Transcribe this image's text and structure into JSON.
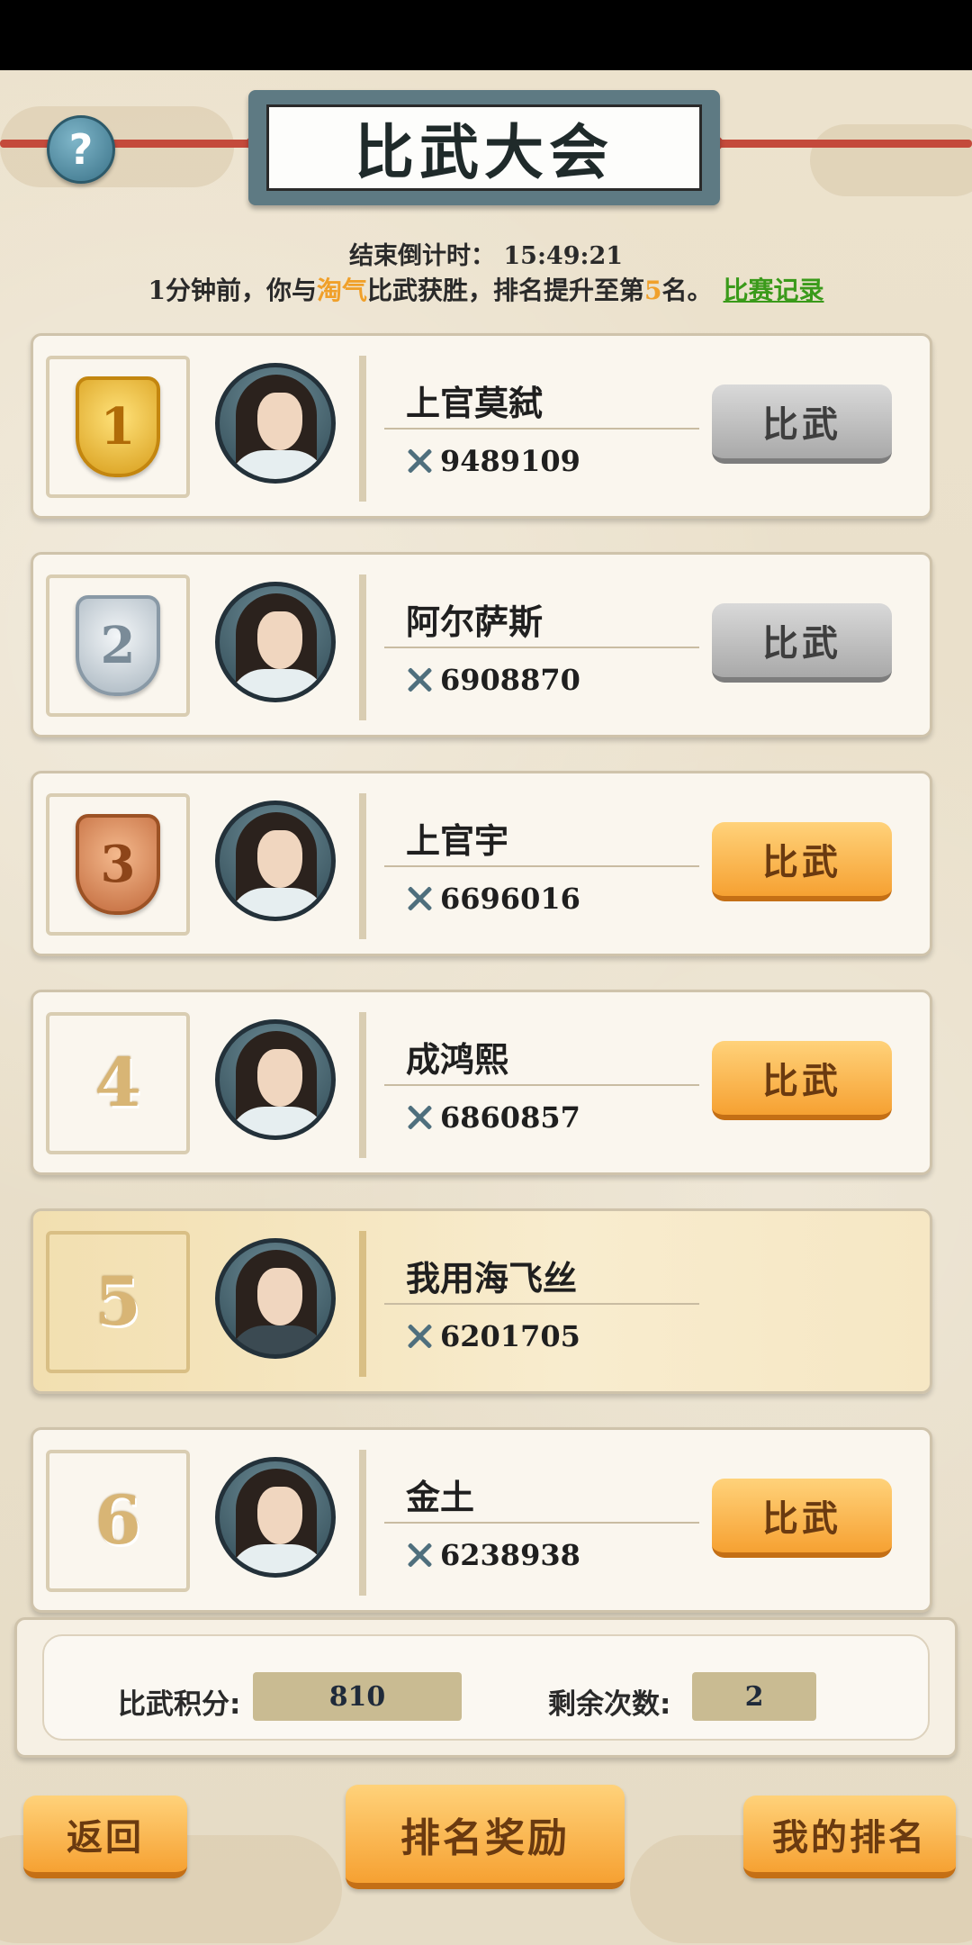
{
  "header": {
    "title": "比武大会",
    "help_icon": "?"
  },
  "countdown": {
    "label": "结束倒计时：",
    "time": "15:49:21"
  },
  "news": {
    "prefix": "1分钟前，你与",
    "opponent": "淘气",
    "middle": "比武获胜，排名提升至第",
    "rank": "5",
    "suffix": "名。",
    "record_link": "比赛记录"
  },
  "ranking": [
    {
      "rank": "1",
      "badge": "gold",
      "name": "上官莫弑",
      "power": "9489109",
      "button": "比武",
      "button_state": "disabled"
    },
    {
      "rank": "2",
      "badge": "silver",
      "name": "阿尔萨斯",
      "power": "6908870",
      "button": "比武",
      "button_state": "disabled"
    },
    {
      "rank": "3",
      "badge": "bronze",
      "name": "上官宇",
      "power": "6696016",
      "button": "比武",
      "button_state": "enabled"
    },
    {
      "rank": "4",
      "badge": "number",
      "name": "成鸿熙",
      "power": "6860857",
      "button": "比武",
      "button_state": "enabled"
    },
    {
      "rank": "5",
      "badge": "number",
      "name": "我用海飞丝",
      "power": "6201705",
      "button": "",
      "button_state": "self"
    },
    {
      "rank": "6",
      "badge": "number",
      "name": "金土",
      "power": "6238938",
      "button": "比武",
      "button_state": "enabled"
    }
  ],
  "stats": {
    "points_label": "比武积分:",
    "points_value": "810",
    "remaining_label": "剩余次数:",
    "remaining_value": "2"
  },
  "buttons": {
    "back": "返回",
    "rank_reward": "排名奖励",
    "my_rank": "我的排名"
  },
  "colors": {
    "accent_orange": "#f6a132",
    "highlight_text": "#f0a02a",
    "link_green": "#3a9a1a",
    "disabled_gray": "#a9a9a9"
  }
}
